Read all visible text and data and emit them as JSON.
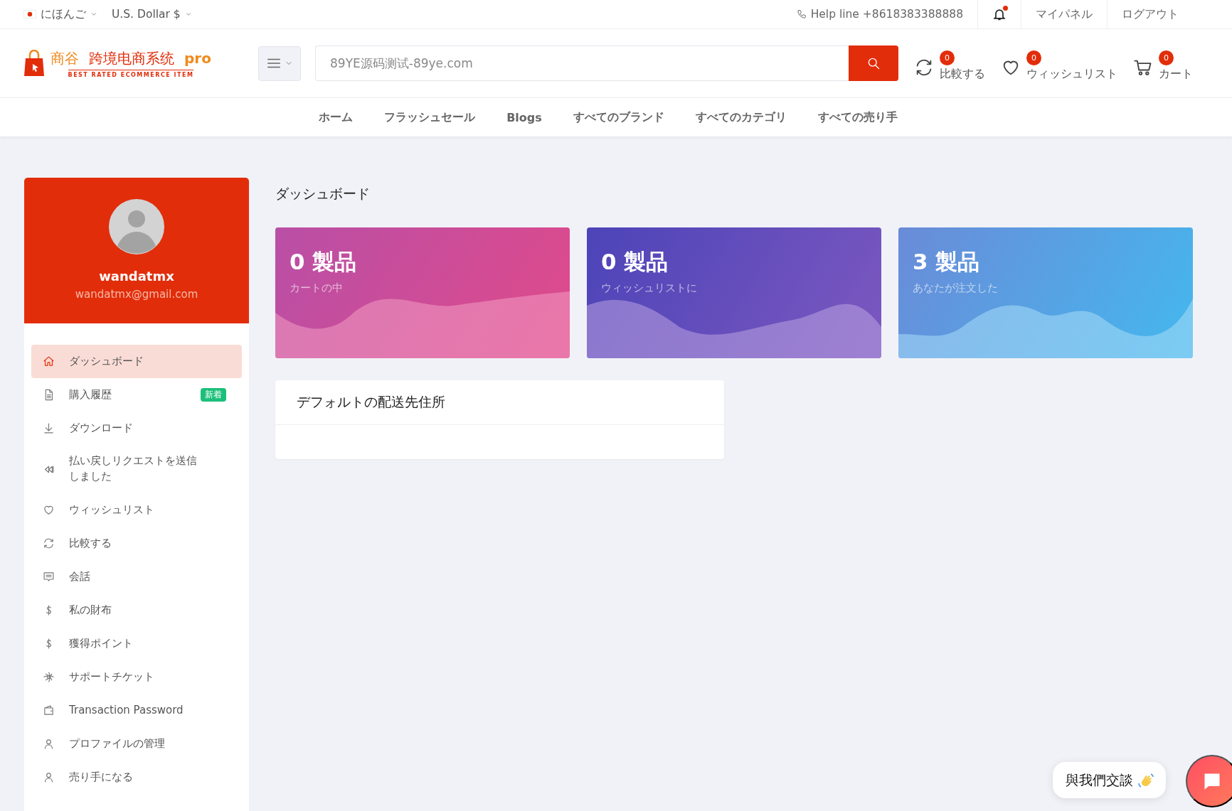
{
  "top_bar": {
    "language": "にほんご",
    "currency": "U.S. Dollar $",
    "help_line": "Help line +8618383388888",
    "notification": true,
    "links": [
      "マイパネル",
      "ログアウト"
    ]
  },
  "header": {
    "logo": {
      "name": "商谷",
      "title": "跨境电商系统",
      "suffix": "pro",
      "tagline": "BEST RATED ECOMMERCE ITEM"
    },
    "search": {
      "placeholder": "89YE源码测试-89ye.com"
    },
    "counters": [
      {
        "label": "比較する",
        "count": "0"
      },
      {
        "label": "ウィッシュリスト",
        "count": "0"
      },
      {
        "label": "カート",
        "count": "0"
      }
    ]
  },
  "nav": [
    "ホーム",
    "フラッシュセール",
    "Blogs",
    "すべてのブランド",
    "すべてのカテゴリ",
    "すべての売り手"
  ],
  "sidebar": {
    "user": {
      "name": "wandatmx",
      "email": "wandatmx@gmail.com"
    },
    "items": [
      {
        "label": "ダッシュボード",
        "selected": true
      },
      {
        "label": "購入履歴",
        "selected": false,
        "badge": "新着"
      },
      {
        "label": "ダウンロード",
        "selected": false
      },
      {
        "label": "払い戻しリクエストを送信しました",
        "selected": false
      },
      {
        "label": "ウィッシュリスト",
        "selected": false
      },
      {
        "label": "比較する",
        "selected": false
      },
      {
        "label": "会話",
        "selected": false
      },
      {
        "label": "私の財布",
        "selected": false
      },
      {
        "label": "獲得ポイント",
        "selected": false
      },
      {
        "label": "サポートチケット",
        "selected": false
      },
      {
        "label": "Transaction Password",
        "selected": false
      },
      {
        "label": "プロファイルの管理",
        "selected": false
      },
      {
        "label": "売り手になる",
        "selected": false
      }
    ]
  },
  "main": {
    "title": "ダッシュボード",
    "stats": [
      {
        "value": "0 製品",
        "caption": "カートの中"
      },
      {
        "value": "0 製品",
        "caption": "ウィッシュリストに"
      },
      {
        "value": "3 製品",
        "caption": "あなたが注文した"
      }
    ],
    "address_card": {
      "title": "デフォルトの配送先住所"
    }
  },
  "chat": {
    "label": "與我們交談"
  }
}
